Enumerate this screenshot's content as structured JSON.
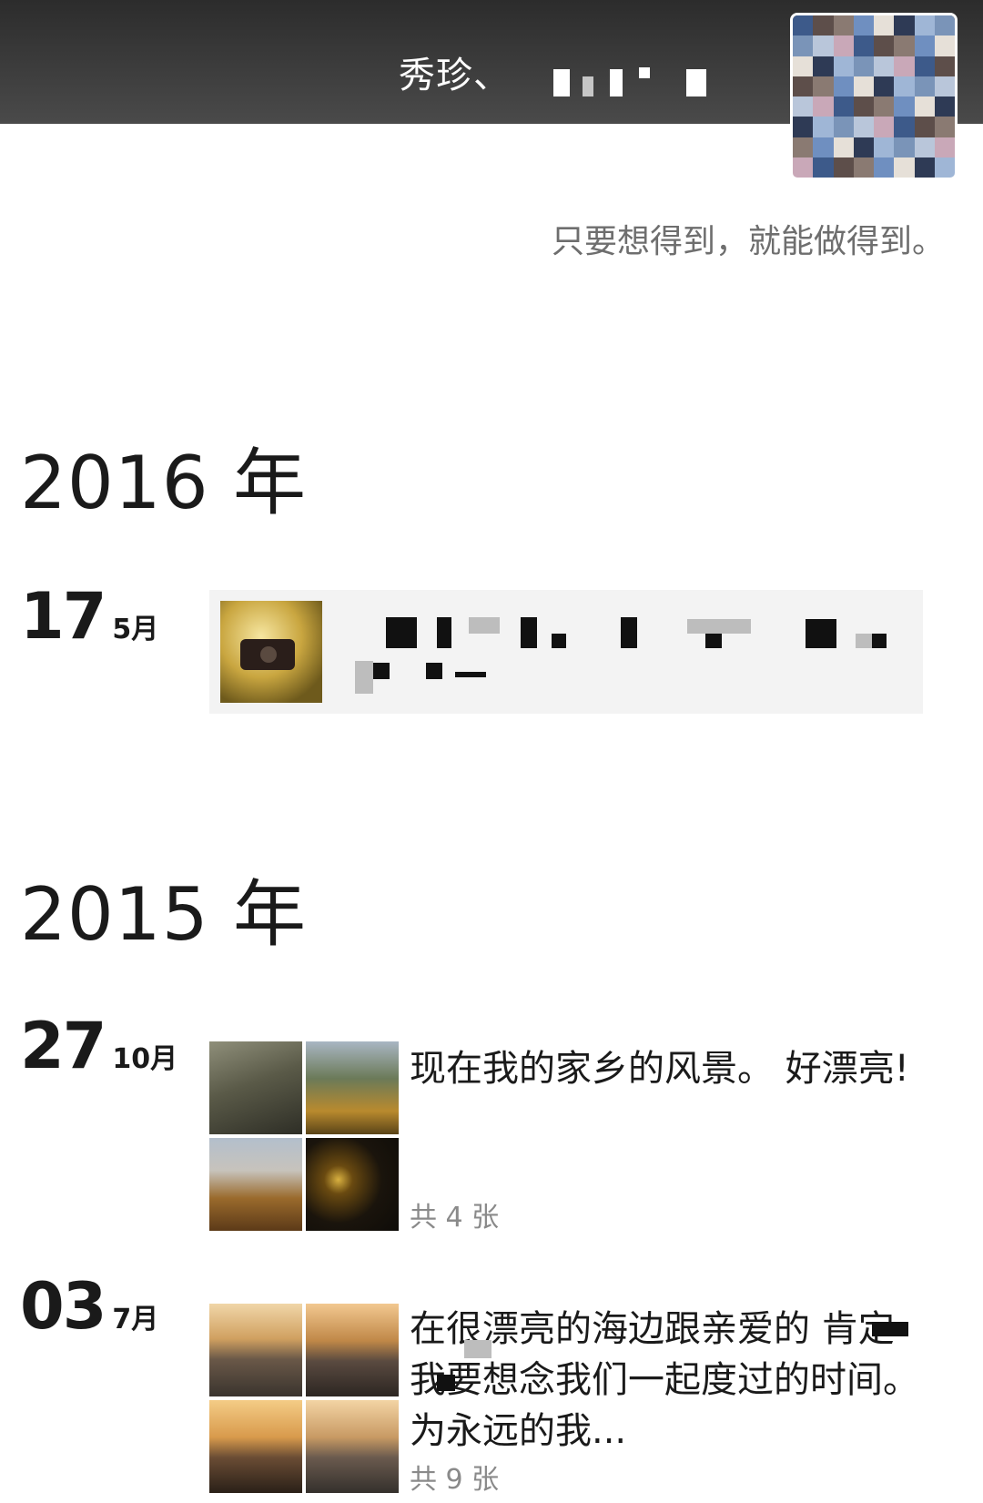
{
  "cover": {
    "name": "秀珍、"
  },
  "profile": {
    "signature": "只要想得到，就能做得到。"
  },
  "timeline": {
    "years": [
      "2016 年",
      "2015 年"
    ],
    "posts": [
      {
        "day": "17",
        "month": "5月"
      },
      {
        "day": "27",
        "month": "10月",
        "text": "现在我的家乡的风景。 好漂亮!",
        "photo_count": "共 4 张"
      },
      {
        "day": "03",
        "month": "7月",
        "text": "在很漂亮的海边跟亲爱的    肯定我要想念我们一起度过的时间。为永远的我...",
        "photo_count": "共 9 张"
      }
    ]
  },
  "colors": {
    "cover_bg": "#3a3a3a",
    "post_bar_bg": "#f3f3f3",
    "muted_text": "#8a8a8a"
  }
}
